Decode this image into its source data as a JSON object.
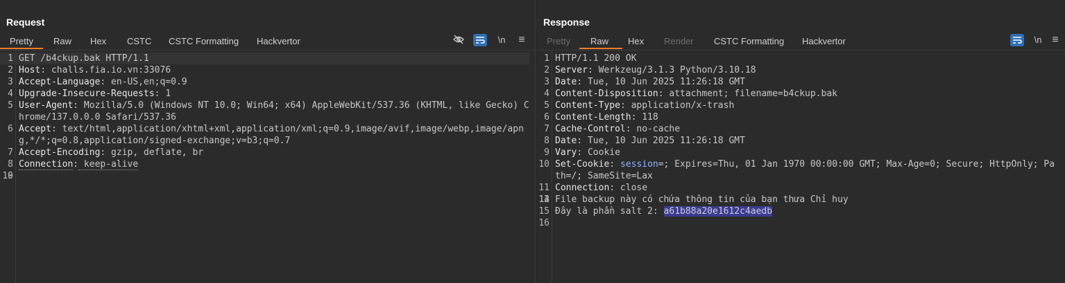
{
  "layout_toggles": [
    {
      "name": "side-by-side",
      "active": true
    },
    {
      "name": "horizontal-split",
      "active": false
    },
    {
      "name": "single-view",
      "active": false
    }
  ],
  "request": {
    "title": "Request",
    "tabs": [
      "Pretty",
      "Raw",
      "Hex",
      "CSTC",
      "CSTC Formatting",
      "Hackvertor"
    ],
    "active_tab": "Pretty",
    "icons": [
      "eye-off-icon",
      "wrap-icon",
      "newline-icon",
      "menu-icon"
    ],
    "newline_label": "\\n",
    "lines": [
      {
        "n": "1",
        "text": "GET /b4ckup.bak HTTP/1.1"
      },
      {
        "n": "2",
        "key": "Host",
        "val": " challs.fia.io.vn:33076"
      },
      {
        "n": "3",
        "key": "Accept-Language",
        "val": " en-US,en;q=0.9"
      },
      {
        "n": "4",
        "key": "Upgrade-Insecure-Requests",
        "val": " 1"
      },
      {
        "n": "5",
        "key": "User-Agent",
        "val": " Mozilla/5.0 (Windows NT 10.0; Win64; x64) AppleWebKit/537.36 (KHTML, like Gecko) Chrome/137.0.0.0 Safari/537.36"
      },
      {
        "n": "6",
        "key": "Accept",
        "val": " text/html,application/xhtml+xml,application/xml;q=0.9,image/avif,image/webp,image/apng,*/*;q=0.8,application/signed-exchange;v=b3;q=0.7"
      },
      {
        "n": "7",
        "key": "Accept-Encoding",
        "val": " gzip, deflate, br"
      },
      {
        "n": "8",
        "key": "Connection",
        "val": " keep-alive"
      },
      {
        "n": "9",
        "text": ""
      },
      {
        "n": "10",
        "text": ""
      }
    ]
  },
  "response": {
    "title": "Response",
    "tabs": [
      "Pretty",
      "Raw",
      "Hex",
      "Render",
      "CSTC Formatting",
      "Hackvertor"
    ],
    "active_tab": "Raw",
    "disabled_tabs": [
      "Pretty",
      "Render"
    ],
    "newline_label": "\\n",
    "lines": [
      {
        "n": "1",
        "text": "HTTP/1.1 200 OK"
      },
      {
        "n": "2",
        "key": "Server",
        "val": " Werkzeug/3.1.3 Python/3.10.18"
      },
      {
        "n": "3",
        "key": "Date",
        "val": " Tue, 10 Jun 2025 11:26:18 GMT"
      },
      {
        "n": "4",
        "key": "Content-Disposition",
        "val": " attachment; filename=b4ckup.bak"
      },
      {
        "n": "5",
        "key": "Content-Type",
        "val": " application/x-trash"
      },
      {
        "n": "6",
        "key": "Content-Length",
        "val": " 118"
      },
      {
        "n": "7",
        "key": "Cache-Control",
        "val": " no-cache"
      },
      {
        "n": "8",
        "key": "Date",
        "val": " Tue, 10 Jun 2025 11:26:18 GMT"
      },
      {
        "n": "9",
        "key": "Vary",
        "val": " Cookie"
      },
      {
        "n": "10",
        "key": "Set-Cookie",
        "cookie": "session",
        "val": "=; Expires=Thu, 01 Jan 1970 00:00:00 GMT; Max-Age=0; Secure; HttpOnly; Path=/; SameSite=Lax"
      },
      {
        "n": "11",
        "key": "Connection",
        "val": " close"
      },
      {
        "n": "12",
        "text": ""
      },
      {
        "n": "13",
        "text": ""
      },
      {
        "n": "14",
        "text": "File backup này có chứa thông tin của bạn thưa Chỉ huy"
      },
      {
        "n": "15",
        "text": "Đây là phần salt 2: ",
        "selected": "a61b88a20e1612c4aedb"
      },
      {
        "n": "16",
        "text": ""
      }
    ]
  }
}
